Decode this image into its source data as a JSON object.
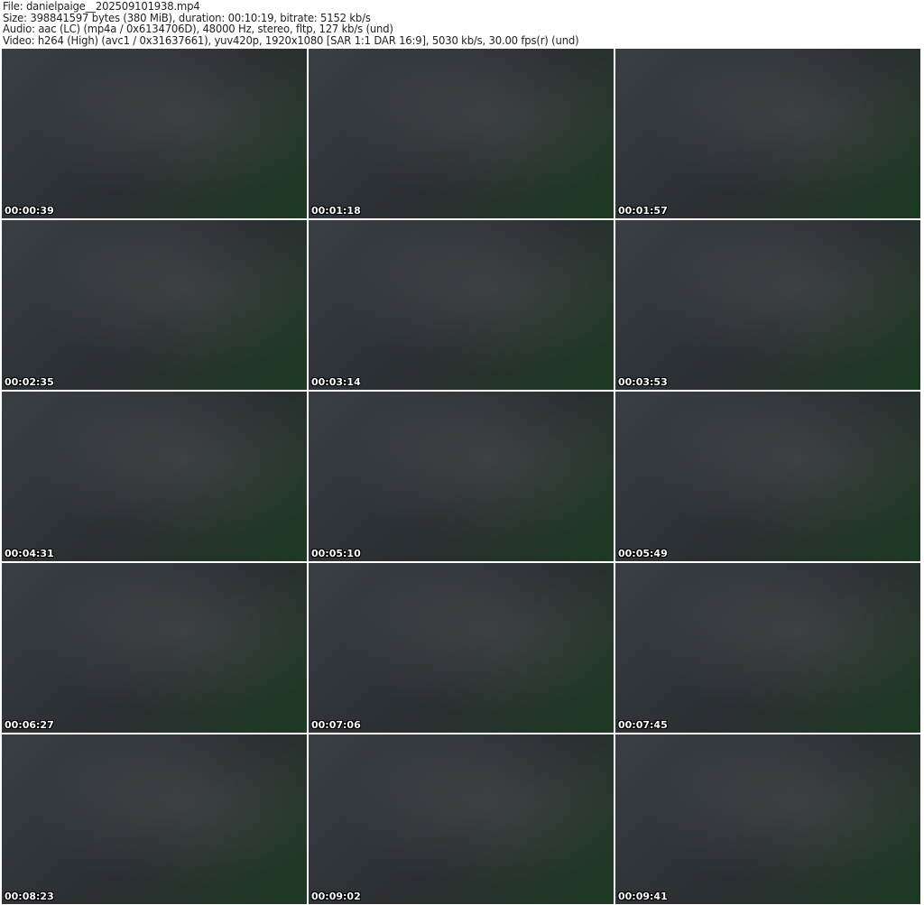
{
  "header": {
    "file": "File: danielpaige__202509101938.mp4",
    "size": "Size: 398841597 bytes (380 MiB), duration: 00:10:19, bitrate: 5152 kb/s",
    "audio": "Audio: aac (LC) (mp4a / 0x6134706D), 48000 Hz, stereo, fltp, 127 kb/s (und)",
    "video": "Video: h264 (High) (avc1 / 0x31637661), yuv420p, 1920x1080 [SAR 1:1 DAR 16:9], 5030 kb/s, 30.00 fps(r) (und)"
  },
  "thumbnails": [
    "00:00:39",
    "00:01:18",
    "00:01:57",
    "00:02:35",
    "00:03:14",
    "00:03:53",
    "00:04:31",
    "00:05:10",
    "00:05:49",
    "00:06:27",
    "00:07:06",
    "00:07:45",
    "00:08:23",
    "00:09:02",
    "00:09:41"
  ]
}
